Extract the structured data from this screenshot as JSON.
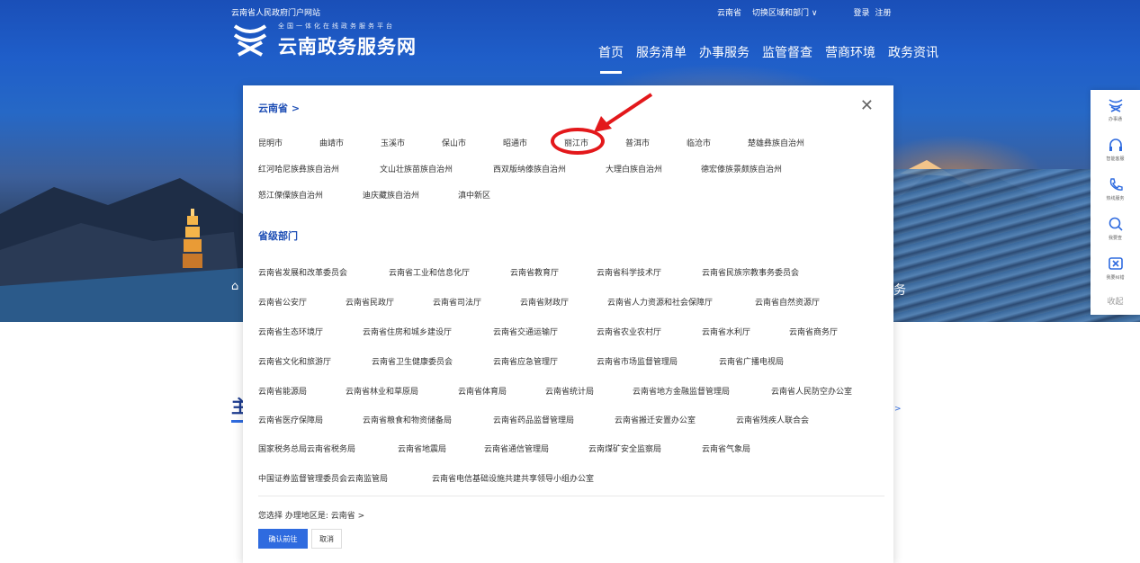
{
  "header": {
    "portal_link": "云南省人民政府门户网站",
    "region": "云南省",
    "switch_region": "切换区域和部门 ∨",
    "login": "登录",
    "register": "注册",
    "logo_subtitle": "全国一体化在线政务服务平台",
    "logo_title": "云南政务服务网",
    "nav": [
      "首页",
      "服务清单",
      "办事服务",
      "监管督查",
      "营商环境",
      "政务资讯"
    ]
  },
  "banner": {
    "tail_text": "务"
  },
  "floatbar": {
    "items": [
      {
        "label": "办事通",
        "icon": "app-logo-icon"
      },
      {
        "label": "智能客服",
        "icon": "headset-icon"
      },
      {
        "label": "热线服务",
        "icon": "phone-icon"
      },
      {
        "label": "我要查",
        "icon": "search-icon"
      },
      {
        "label": "我要纠错",
        "icon": "error-report-icon"
      }
    ],
    "collapse": "收起"
  },
  "modal": {
    "province_title": "云南省 >",
    "cities": [
      [
        "昆明市",
        "曲靖市",
        "玉溪市",
        "保山市",
        "昭通市",
        "丽江市",
        "普洱市",
        "临沧市",
        "楚雄彝族自治州"
      ],
      [
        "红河哈尼族彝族自治州",
        "文山壮族苗族自治州",
        "西双版纳傣族自治州",
        "大理白族自治州",
        "德宏傣族景颇族自治州"
      ],
      [
        "怒江傈僳族自治州",
        "迪庆藏族自治州",
        "滇中新区"
      ]
    ],
    "dept_title": "省级部门",
    "depts": [
      [
        "云南省发展和改革委员会",
        "云南省工业和信息化厅",
        "云南省教育厅",
        "云南省科学技术厅",
        "云南省民族宗教事务委员会"
      ],
      [
        "云南省公安厅",
        "云南省民政厅",
        "云南省司法厅",
        "云南省财政厅",
        "云南省人力资源和社会保障厅",
        "云南省自然资源厅"
      ],
      [
        "云南省生态环境厅",
        "云南省住房和城乡建设厅",
        "云南省交通运输厅",
        "云南省农业农村厅",
        "云南省水利厅",
        "云南省商务厅"
      ],
      [
        "云南省文化和旅游厅",
        "云南省卫生健康委员会",
        "云南省应急管理厅",
        "云南省市场监督管理局",
        "云南省广播电视局"
      ],
      [
        "云南省能源局",
        "云南省林业和草原局",
        "云南省体育局",
        "云南省统计局",
        "云南省地方金融监督管理局",
        "云南省人民防空办公室"
      ],
      [
        "云南省医疗保障局",
        "云南省粮食和物资储备局",
        "云南省药品监督管理局",
        "云南省搬迁安置办公室",
        "云南省残疾人联合会"
      ],
      [
        "国家税务总局云南省税务局",
        "云南省地震局",
        "云南省通信管理局",
        "云南煤矿安全监察局",
        "云南省气象局"
      ],
      [
        "中国证券监督管理委员会云南监管局",
        "云南省电信基础设施共建共享领导小组办公室"
      ]
    ],
    "choice_text": "您选择  办理地区是: 云南省 >",
    "confirm": "确认前往",
    "cancel": "取消"
  },
  "colors": {
    "accent": "#2f6bdf",
    "annotation": "#e3181b"
  }
}
